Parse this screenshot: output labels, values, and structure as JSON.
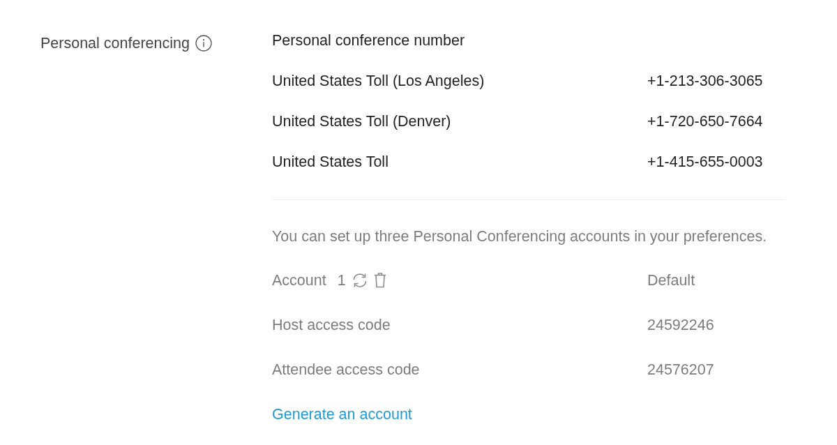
{
  "section": {
    "label": "Personal conferencing"
  },
  "conference_numbers": {
    "heading": "Personal conference number",
    "rows": [
      {
        "name": "United States Toll (Los Angeles)",
        "number": "+1-213-306-3065"
      },
      {
        "name": "United States Toll (Denver)",
        "number": "+1-720-650-7664"
      },
      {
        "name": "United States Toll",
        "number": "+1-415-655-0003"
      }
    ]
  },
  "accounts_note": "You can set up three Personal Conferencing accounts in your preferences.",
  "account": {
    "label": "Account",
    "index": "1",
    "status": "Default",
    "fields": [
      {
        "label": "Host access code",
        "value": "24592246"
      },
      {
        "label": "Attendee access code",
        "value": "24576207"
      }
    ]
  },
  "generate_link": "Generate an account"
}
